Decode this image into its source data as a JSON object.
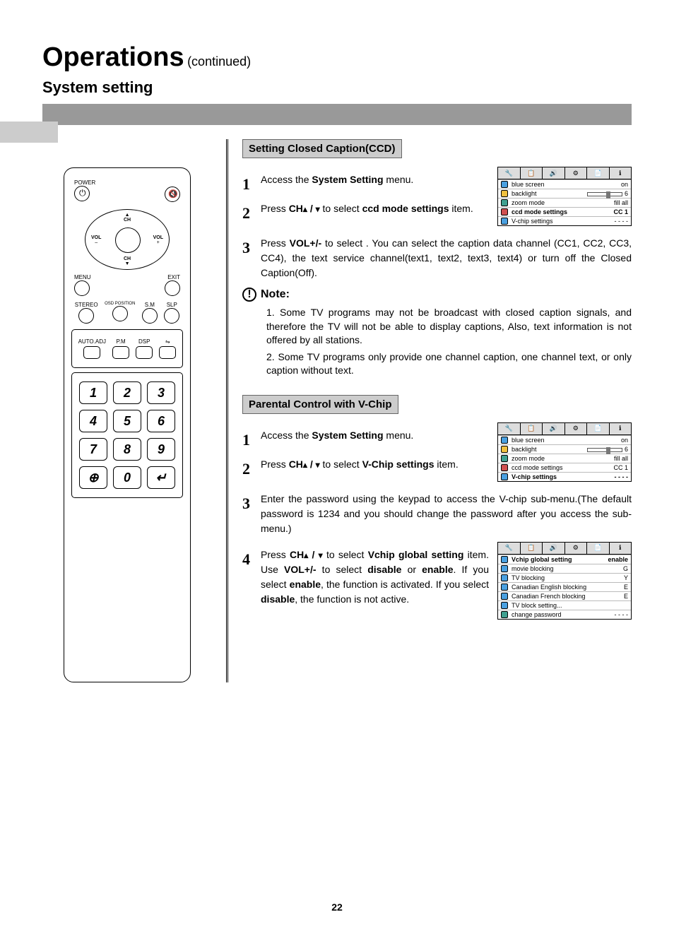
{
  "header": {
    "title": "Operations",
    "continued": "(continued)",
    "subtitle": "System setting"
  },
  "remote": {
    "power": "POWER",
    "ch": "CH",
    "vol_minus": "VOL\n–",
    "vol_plus": "VOL\n+",
    "menu": "MENU",
    "exit": "EXIT",
    "row1": [
      "STEREO",
      "OSD POSITION",
      "S.M",
      "SLP"
    ],
    "row2": [
      "AUTO.ADJ",
      "P.M",
      "DSP",
      ""
    ],
    "keys": [
      "1",
      "2",
      "3",
      "4",
      "5",
      "6",
      "7",
      "8",
      "9",
      "",
      "0",
      ""
    ]
  },
  "ccd": {
    "heading": "Setting Closed Caption(CCD)",
    "steps": [
      {
        "n": "1",
        "pre": "Access the ",
        "b": "System Setting",
        "post": " menu."
      },
      {
        "n": "2",
        "pre": "Press ",
        "b": "CH",
        "arrows": true,
        "post_b": "ccd mode settings",
        "mid": " to select ",
        "post": " item."
      },
      {
        "n": "3",
        "pre": "Press ",
        "b": "VOL+/-",
        "post": " to select . You can select the caption data channel (CC1, CC2, CC3, CC4), the text service channel(text1, text2, text3, text4) or turn off the Closed Caption(Off)."
      }
    ],
    "note_label": "Note",
    "notes": [
      "1. Some TV programs may not be broadcast with closed caption signals, and therefore the TV will not be able to display captions, Also, text information is not offered by all stations.",
      "2. Some TV programs only provide one channel caption, one channel text, or only caption without text."
    ],
    "osd": {
      "rows": [
        {
          "label": "blue screen",
          "val": "on",
          "ic": "ic-blue"
        },
        {
          "label": "backlight",
          "val": "6",
          "slider": true,
          "ic": "ic-bulb"
        },
        {
          "label": "zoom mode",
          "val": "fill all",
          "ic": "ic-teal"
        },
        {
          "label": "ccd mode settings",
          "val": "CC 1",
          "sel": true,
          "ic": "ic-red"
        },
        {
          "label": "V-chip settings",
          "val": "- - - -",
          "ic": "ic-blue"
        }
      ]
    }
  },
  "vchip": {
    "heading": "Parental Control with V-Chip",
    "steps": [
      {
        "n": "1",
        "pre": "Access the ",
        "b": "System Setting",
        "post": " menu."
      },
      {
        "n": "2",
        "pre": "Press ",
        "b": "CH",
        "arrows": true,
        "mid": " to select ",
        "post_b": "V-Chip settings",
        "post": " item."
      },
      {
        "n": "3",
        "plain": "Enter the password using the keypad to access the V-chip sub-menu.(The default password is 1234 and you should  change the password after you access the  sub-menu.)"
      },
      {
        "n": "4",
        "pre": "Press ",
        "b": "CH",
        "arrows": true,
        "mid": " to select ",
        "post_b": "Vchip global setting",
        "post2": " item. Use ",
        "b2": "VOL+/-",
        "post3": " to select ",
        "b3": "disable",
        "post4": " or ",
        "b4": "enable",
        "post5": ". If you select ",
        "b5": "enable",
        "post6": ", the function is activated. If you select ",
        "b6": "disable",
        "post7": ", the function is not active."
      }
    ],
    "osd1": {
      "rows": [
        {
          "label": "blue screen",
          "val": "on",
          "ic": "ic-blue"
        },
        {
          "label": "backlight",
          "val": "6",
          "slider": true,
          "ic": "ic-bulb"
        },
        {
          "label": "zoom mode",
          "val": "fill all",
          "ic": "ic-teal"
        },
        {
          "label": "ccd mode settings",
          "val": "CC 1",
          "ic": "ic-red"
        },
        {
          "label": "V-chip settings",
          "val": "- - - -",
          "sel": true,
          "ic": "ic-blue"
        }
      ]
    },
    "osd2": {
      "rows": [
        {
          "label": "Vchip global setting",
          "val": "enable",
          "sel": true,
          "ic": "ic-blue"
        },
        {
          "label": "movie blocking",
          "val": "G",
          "ic": "ic-blue"
        },
        {
          "label": "TV blocking",
          "val": "Y",
          "ic": "ic-blue"
        },
        {
          "label": "Canadian English blocking",
          "val": "E",
          "ic": "ic-blue"
        },
        {
          "label": "Canadian French blocking",
          "val": "E",
          "ic": "ic-blue"
        },
        {
          "label": "TV block setting...",
          "val": "",
          "ic": "ic-blue"
        },
        {
          "label": "change password",
          "val": "- - - -",
          "ic": "ic-teal"
        }
      ]
    }
  },
  "page_number": "22"
}
